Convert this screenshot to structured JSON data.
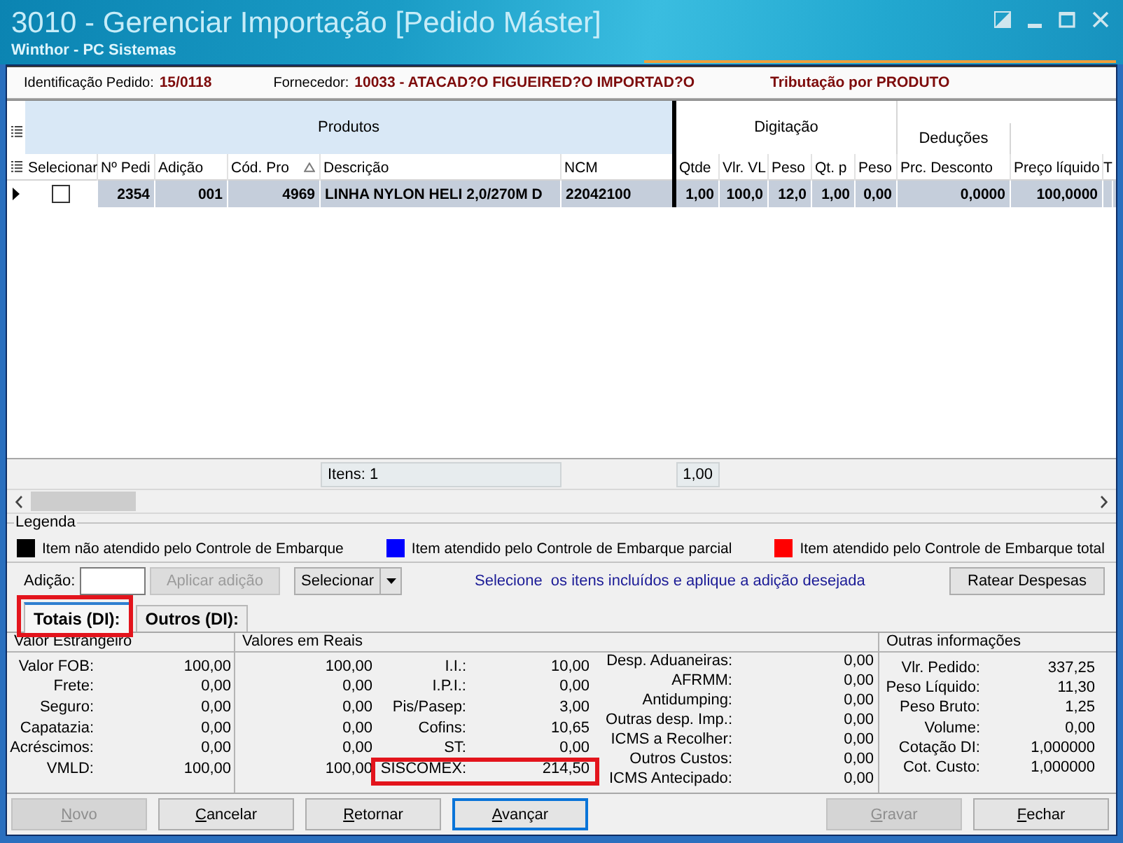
{
  "window": {
    "title": "3010 - Gerenciar Importação [Pedido Máster]",
    "subtitle": "Winthor - PC Sistemas"
  },
  "order_info": [
    {
      "label": "Identificação Pedido:",
      "value": "15/0118"
    },
    {
      "label": "Fornecedor:",
      "value": "10033 - ATACAD?O FIGUEIRED?O IMPORTAD?O"
    }
  ],
  "taxation": "Tributação por PRODUTO",
  "grid": {
    "groups": [
      {
        "label": "Produtos",
        "kind": "full",
        "frozen": true,
        "columns": [
          {
            "label": "Selecionar",
            "kind": "checkbox",
            "sorted": false
          },
          {
            "label": "Nº Pedi",
            "kind": "text",
            "sorted": false
          },
          {
            "label": "Adição",
            "kind": "text",
            "sorted": false
          },
          {
            "label": "Cód. Pro",
            "kind": "text",
            "sorted": true
          },
          {
            "label": "Descrição",
            "kind": "text",
            "sorted": false,
            "total": "Itens: 1"
          },
          {
            "label": "NCM",
            "kind": "text",
            "sorted": false
          }
        ]
      },
      {
        "label": "Digitação",
        "kind": "full",
        "frozen": false,
        "columns": [
          {
            "label": "Qtde",
            "kind": "text",
            "sorted": false,
            "total": "1,00"
          },
          {
            "label": "Vlr. VL",
            "kind": "text",
            "sorted": false
          },
          {
            "label": "Peso",
            "kind": "text",
            "sorted": false
          },
          {
            "label": "Qt. p",
            "kind": "text",
            "sorted": false
          },
          {
            "label": "Peso",
            "kind": "text",
            "sorted": false
          }
        ]
      },
      {
        "label": "Deduções",
        "kind": "lower",
        "frozen": false,
        "columns": [
          {
            "label": "Prc. Desconto",
            "kind": "text",
            "sorted": false
          }
        ]
      },
      {
        "kind": "blank",
        "columns": [
          {
            "label": "Preço líquido",
            "kind": "text",
            "sorted": false
          },
          {
            "label": "T",
            "kind": "text",
            "sorted": false
          }
        ]
      }
    ],
    "rows": [
      {
        "selected": true,
        "checked": false,
        "cells": [
          "2354",
          "001",
          "4969",
          "LINHA NYLON HELI 2,0/270M D",
          "22042100",
          "1,00",
          "100,0",
          "12,0",
          "1,00",
          "0,00",
          "0,0000",
          "100,0000"
        ]
      }
    ]
  },
  "legend": {
    "title": "Legenda",
    "items": [
      {
        "label": "Item não atendido pelo Controle de Embarque",
        "color": "#000000"
      },
      {
        "label": "Item atendido pelo Controle de Embarque parcial",
        "color": "#0000ff"
      },
      {
        "label": "Item atendido pelo Controle de Embarque total",
        "color": "#ff0000"
      }
    ]
  },
  "adicao": {
    "label": "Adição:",
    "apply_button": {
      "label": "Aplicar adição",
      "disabled": true
    },
    "select_button": "Selecionar",
    "hint": "Selecione  os itens incluídos e aplique a adição desejada",
    "apportion_button": "Ratear Despesas"
  },
  "tabs": [
    {
      "label": "Totais (DI):",
      "selected": true,
      "highlighted": true
    },
    {
      "label": "Outros (DI):",
      "selected": false,
      "highlighted": false
    }
  ],
  "foreign_values": {
    "title": "Valor Estrangeiro",
    "rows": [
      {
        "label": "Valor FOB:",
        "value": "100,00"
      },
      {
        "label": "Frete:",
        "value": "0,00"
      },
      {
        "label": "Seguro:",
        "value": "0,00"
      },
      {
        "label": "Capatazia:",
        "value": "0,00"
      },
      {
        "label": "Acréscimos:",
        "value": "0,00"
      },
      {
        "label": "VMLD:",
        "value": "100,00"
      }
    ]
  },
  "real_values": {
    "title": "Valores em Reais",
    "base_values": [
      "100,00",
      "0,00",
      "0,00",
      "0,00",
      "0,00",
      "100,00"
    ],
    "taxes": [
      {
        "label": "I.I.:",
        "value": "10,00",
        "highlighted": false
      },
      {
        "label": "I.P.I.:",
        "value": "0,00",
        "highlighted": false
      },
      {
        "label": "Pis/Pasep:",
        "value": "3,00",
        "highlighted": false
      },
      {
        "label": "Cofins:",
        "value": "10,65",
        "highlighted": false
      },
      {
        "label": "ST:",
        "value": "0,00",
        "highlighted": false
      },
      {
        "label": "SISCOMEX:",
        "value": "214,50",
        "highlighted": true
      }
    ],
    "expenses": [
      {
        "label": "Desp. Aduaneiras:",
        "value": "0,00"
      },
      {
        "label": "AFRMM:",
        "value": "0,00"
      },
      {
        "label": "Antidumping:",
        "value": "0,00"
      },
      {
        "label": "Outras desp. Imp.:",
        "value": "0,00"
      },
      {
        "label": "ICMS a Recolher:",
        "value": "0,00"
      },
      {
        "label": "Outros Custos:",
        "value": "0,00"
      },
      {
        "label": "ICMS Antecipado:",
        "value": "0,00"
      }
    ]
  },
  "other_info": {
    "title": "Outras informações",
    "rows": [
      {
        "label": "Vlr. Pedido:",
        "value": "337,25"
      },
      {
        "label": "Peso Líquido:",
        "value": "11,30"
      },
      {
        "label": "Peso Bruto:",
        "value": "1,25"
      },
      {
        "label": "Volume:",
        "value": "0,00"
      },
      {
        "label": "Cotação DI:",
        "value": "1,000000"
      },
      {
        "label": "Cot. Custo:",
        "value": "1,000000"
      }
    ]
  },
  "buttons": {
    "left": [
      {
        "label": "Novo",
        "disabled": true,
        "focused": false
      },
      {
        "label": "Cancelar",
        "disabled": false,
        "focused": false
      },
      {
        "label": "Retornar",
        "disabled": false,
        "focused": false
      },
      {
        "label": "Avançar",
        "disabled": false,
        "focused": true
      }
    ],
    "right": [
      {
        "label": "Gravar",
        "disabled": true,
        "focused": false
      },
      {
        "label": "Fechar",
        "disabled": false,
        "focused": false
      }
    ]
  }
}
